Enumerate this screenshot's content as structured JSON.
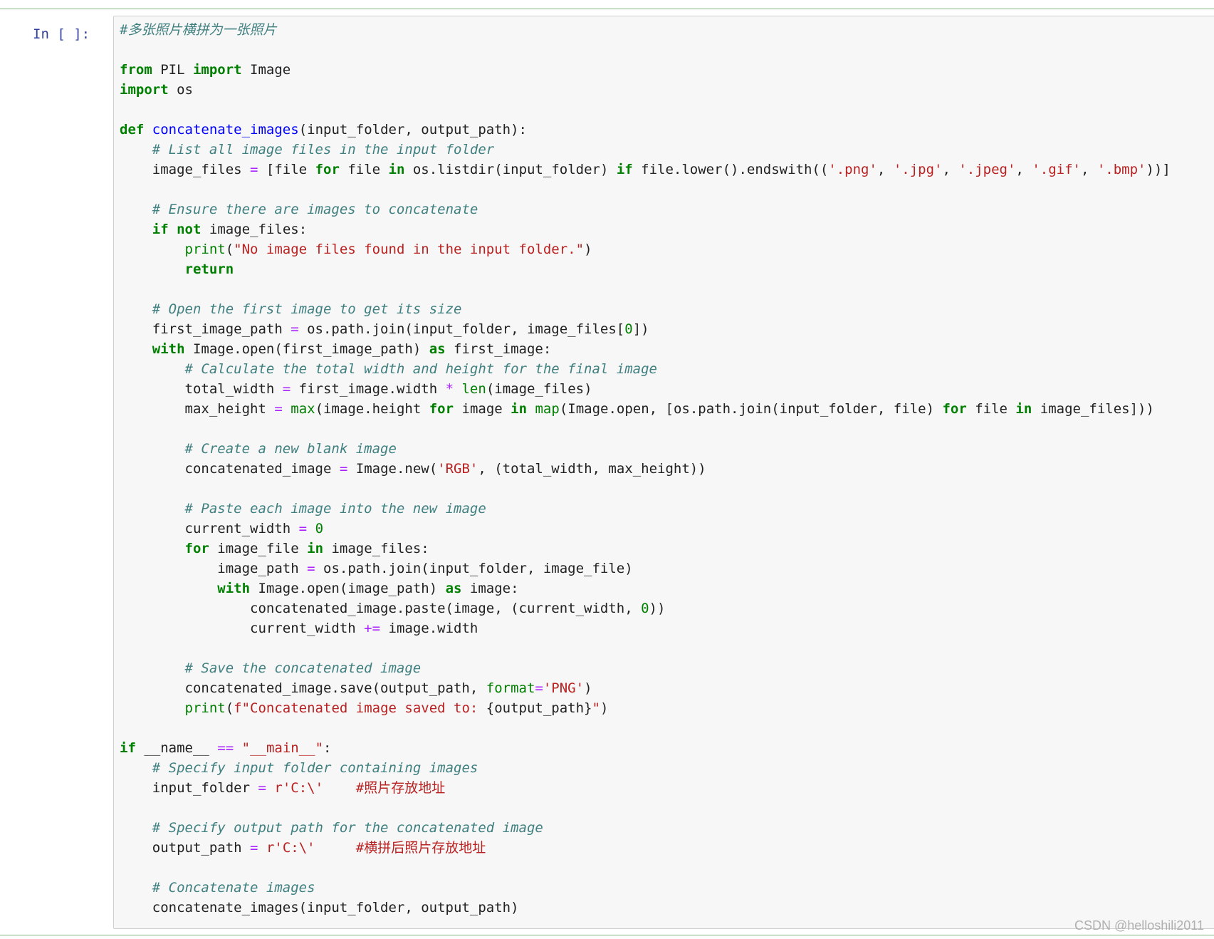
{
  "prompt": "In [ ]:",
  "watermark": "CSDN @helloshili2011",
  "lines": [
    [
      [
        "c",
        "#多张照片横拼为一张照片"
      ]
    ],
    [],
    [
      [
        "k",
        "from"
      ],
      [
        "n",
        " PIL "
      ],
      [
        "k",
        "import"
      ],
      [
        "n",
        " Image"
      ]
    ],
    [
      [
        "k",
        "import"
      ],
      [
        "n",
        " os"
      ]
    ],
    [],
    [
      [
        "k",
        "def"
      ],
      [
        "n",
        " "
      ],
      [
        "f",
        "concatenate_images"
      ],
      [
        "n",
        "(input_folder, output_path):"
      ]
    ],
    [
      [
        "n",
        "    "
      ],
      [
        "c",
        "# List all image files in the input folder"
      ]
    ],
    [
      [
        "n",
        "    image_files "
      ],
      [
        "o",
        "="
      ],
      [
        "n",
        " [file "
      ],
      [
        "k",
        "for"
      ],
      [
        "n",
        " file "
      ],
      [
        "k",
        "in"
      ],
      [
        "n",
        " os.listdir(input_folder) "
      ],
      [
        "k",
        "if"
      ],
      [
        "n",
        " file.lower().endswith(("
      ],
      [
        "s",
        "'.png'"
      ],
      [
        "n",
        ", "
      ],
      [
        "s",
        "'.jpg'"
      ],
      [
        "n",
        ", "
      ],
      [
        "s",
        "'.jpeg'"
      ],
      [
        "n",
        ", "
      ],
      [
        "s",
        "'.gif'"
      ],
      [
        "n",
        ", "
      ],
      [
        "s",
        "'.bmp'"
      ],
      [
        "n",
        "))]"
      ]
    ],
    [],
    [
      [
        "n",
        "    "
      ],
      [
        "c",
        "# Ensure there are images to concatenate"
      ]
    ],
    [
      [
        "n",
        "    "
      ],
      [
        "k",
        "if"
      ],
      [
        "n",
        " "
      ],
      [
        "k",
        "not"
      ],
      [
        "n",
        " image_files:"
      ]
    ],
    [
      [
        "n",
        "        "
      ],
      [
        "b",
        "print"
      ],
      [
        "n",
        "("
      ],
      [
        "s",
        "\"No image files found in the input folder.\""
      ],
      [
        "n",
        ")"
      ]
    ],
    [
      [
        "n",
        "        "
      ],
      [
        "k",
        "return"
      ]
    ],
    [],
    [
      [
        "n",
        "    "
      ],
      [
        "c",
        "# Open the first image to get its size"
      ]
    ],
    [
      [
        "n",
        "    first_image_path "
      ],
      [
        "o",
        "="
      ],
      [
        "n",
        " os.path.join(input_folder, image_files["
      ],
      [
        "m",
        "0"
      ],
      [
        "n",
        "])"
      ]
    ],
    [
      [
        "n",
        "    "
      ],
      [
        "k",
        "with"
      ],
      [
        "n",
        " Image.open(first_image_path) "
      ],
      [
        "k",
        "as"
      ],
      [
        "n",
        " first_image:"
      ]
    ],
    [
      [
        "n",
        "        "
      ],
      [
        "c",
        "# Calculate the total width and height for the final image"
      ]
    ],
    [
      [
        "n",
        "        total_width "
      ],
      [
        "o",
        "="
      ],
      [
        "n",
        " first_image.width "
      ],
      [
        "o",
        "*"
      ],
      [
        "n",
        " "
      ],
      [
        "b",
        "len"
      ],
      [
        "n",
        "(image_files)"
      ]
    ],
    [
      [
        "n",
        "        max_height "
      ],
      [
        "o",
        "="
      ],
      [
        "n",
        " "
      ],
      [
        "b",
        "max"
      ],
      [
        "n",
        "(image.height "
      ],
      [
        "k",
        "for"
      ],
      [
        "n",
        " image "
      ],
      [
        "k",
        "in"
      ],
      [
        "n",
        " "
      ],
      [
        "b",
        "map"
      ],
      [
        "n",
        "(Image.open, [os.path.join(input_folder, file) "
      ],
      [
        "k",
        "for"
      ],
      [
        "n",
        " file "
      ],
      [
        "k",
        "in"
      ],
      [
        "n",
        " image_files]))"
      ]
    ],
    [],
    [
      [
        "n",
        "        "
      ],
      [
        "c",
        "# Create a new blank image"
      ]
    ],
    [
      [
        "n",
        "        concatenated_image "
      ],
      [
        "o",
        "="
      ],
      [
        "n",
        " Image.new("
      ],
      [
        "s",
        "'RGB'"
      ],
      [
        "n",
        ", (total_width, max_height))"
      ]
    ],
    [],
    [
      [
        "n",
        "        "
      ],
      [
        "c",
        "# Paste each image into the new image"
      ]
    ],
    [
      [
        "n",
        "        current_width "
      ],
      [
        "o",
        "="
      ],
      [
        "n",
        " "
      ],
      [
        "m",
        "0"
      ]
    ],
    [
      [
        "n",
        "        "
      ],
      [
        "k",
        "for"
      ],
      [
        "n",
        " image_file "
      ],
      [
        "k",
        "in"
      ],
      [
        "n",
        " image_files:"
      ]
    ],
    [
      [
        "n",
        "            image_path "
      ],
      [
        "o",
        "="
      ],
      [
        "n",
        " os.path.join(input_folder, image_file)"
      ]
    ],
    [
      [
        "n",
        "            "
      ],
      [
        "k",
        "with"
      ],
      [
        "n",
        " Image.open(image_path) "
      ],
      [
        "k",
        "as"
      ],
      [
        "n",
        " image:"
      ]
    ],
    [
      [
        "n",
        "                concatenated_image.paste(image, (current_width, "
      ],
      [
        "m",
        "0"
      ],
      [
        "n",
        "))"
      ]
    ],
    [
      [
        "n",
        "                current_width "
      ],
      [
        "o",
        "+="
      ],
      [
        "n",
        " image.width"
      ]
    ],
    [],
    [
      [
        "n",
        "        "
      ],
      [
        "c",
        "# Save the concatenated image"
      ]
    ],
    [
      [
        "n",
        "        concatenated_image.save(output_path, "
      ],
      [
        "a",
        "format"
      ],
      [
        "o",
        "="
      ],
      [
        "s",
        "'PNG'"
      ],
      [
        "n",
        ")"
      ]
    ],
    [
      [
        "n",
        "        "
      ],
      [
        "b",
        "print"
      ],
      [
        "n",
        "("
      ],
      [
        "s",
        "f\"Concatenated image saved to: "
      ],
      [
        "n",
        "{output_path}"
      ],
      [
        "s",
        "\""
      ],
      [
        "n",
        ")"
      ]
    ],
    [],
    [
      [
        "k",
        "if"
      ],
      [
        "n",
        " __name__ "
      ],
      [
        "o",
        "=="
      ],
      [
        "n",
        " "
      ],
      [
        "s",
        "\"__main__\""
      ],
      [
        "n",
        ":"
      ]
    ],
    [
      [
        "n",
        "    "
      ],
      [
        "c",
        "# Specify input folder containing images"
      ]
    ],
    [
      [
        "n",
        "    input_folder "
      ],
      [
        "o",
        "="
      ],
      [
        "n",
        " "
      ],
      [
        "s",
        "r'C:\\'"
      ],
      [
        "n",
        "    "
      ],
      [
        "s",
        "#照片存放地址"
      ]
    ],
    [],
    [
      [
        "n",
        "    "
      ],
      [
        "c",
        "# Specify output path for the concatenated image"
      ]
    ],
    [
      [
        "n",
        "    output_path "
      ],
      [
        "o",
        "="
      ],
      [
        "n",
        " "
      ],
      [
        "s",
        "r'C:\\'"
      ],
      [
        "n",
        "     "
      ],
      [
        "s",
        "#横拼后照片存放地址"
      ]
    ],
    [],
    [
      [
        "n",
        "    "
      ],
      [
        "c",
        "# Concatenate images"
      ]
    ],
    [
      [
        "n",
        "    concatenate_images(input_folder, output_path)"
      ]
    ]
  ]
}
